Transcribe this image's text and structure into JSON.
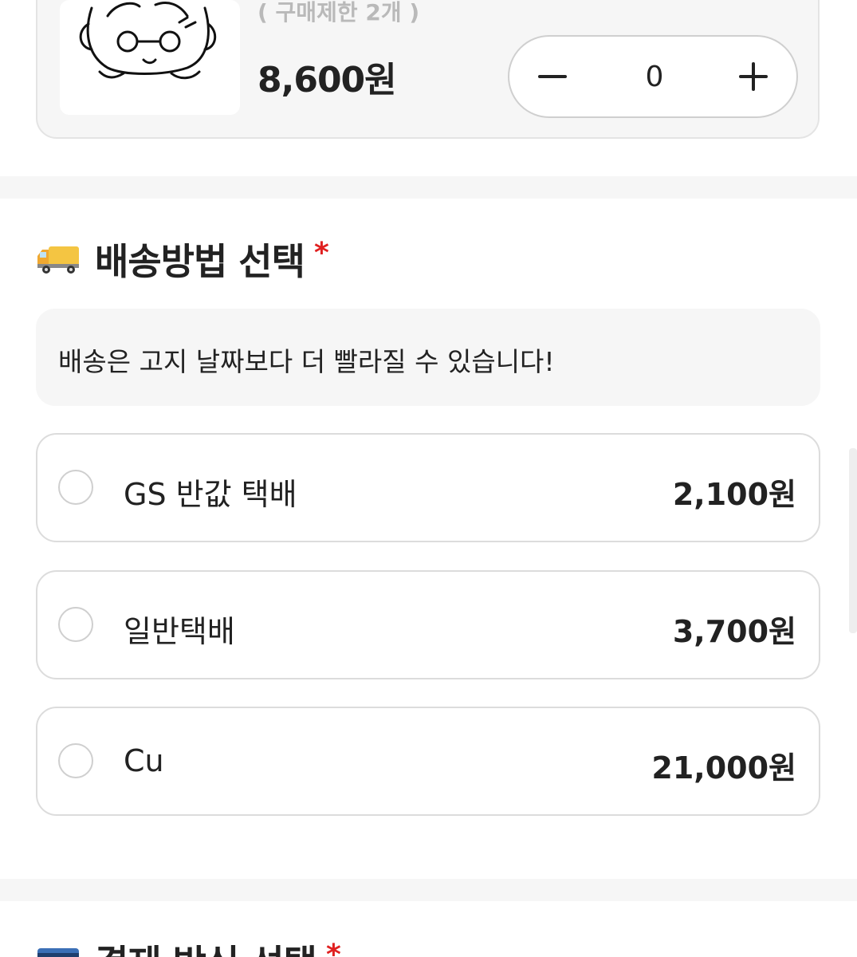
{
  "product": {
    "limit_text": "( 구매제한 2개 )",
    "price": "8,600원",
    "quantity": "0"
  },
  "shipping": {
    "icon": "truck-icon",
    "title": "배송방법 선택",
    "required_mark": "*",
    "notice": "배송은 고지 날짜보다 더 빨라질 수 있습니다!",
    "options": [
      {
        "label": "GS 반값 택배",
        "price": "2,100원"
      },
      {
        "label": "일반택배",
        "price": "3,700원"
      },
      {
        "label": "Cu",
        "price": "21,000원"
      }
    ]
  },
  "payment": {
    "icon": "credit-card-icon",
    "title": "결제 방식 선택",
    "required_mark": "*"
  },
  "colors": {
    "required": "#e02020",
    "card_background": "#f6f6f6",
    "border": "#dcdcdc",
    "text": "#222222"
  }
}
